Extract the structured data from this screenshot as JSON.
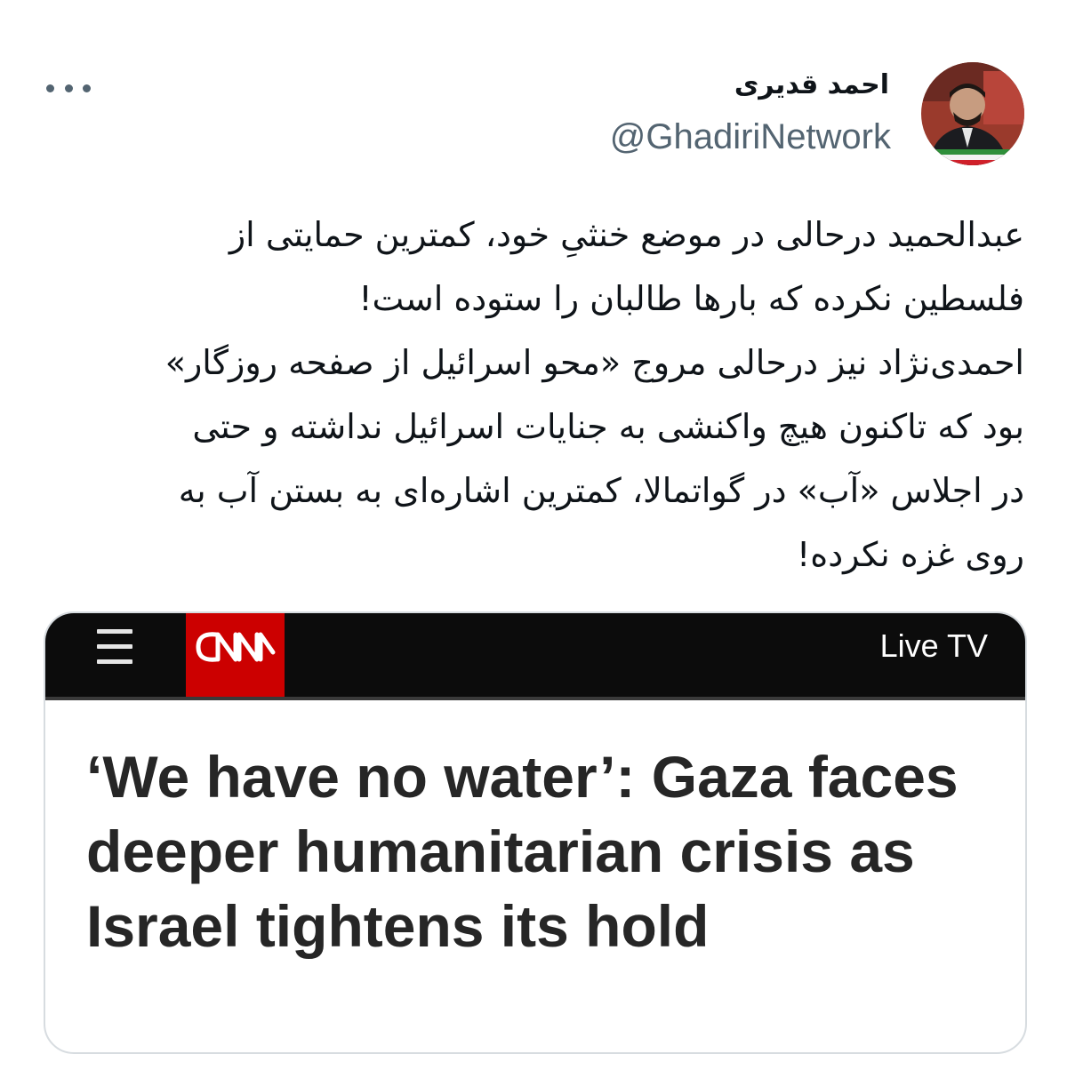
{
  "tweet": {
    "author_name": "احمد قدیری",
    "author_handle": "@GhadiriNetwork",
    "more_icon": "more-horizontal-icon",
    "text_lines": [
      "عبدالحمید درحالی در موضع خنثیِ خود، کمترین حمایتی از",
      "فلسطین نکرده که بارها طالبان را ستوده است!",
      "احمدی‌نژاد نیز درحالی مروج «محو اسرائیل از صفحه روزگار»",
      "بود که تاکنون هیچ واکنشی به جنایات اسرائیل نداشته و حتی",
      "در اجلاس «آب» در گواتمالا، کمترین اشاره‌ای به بستن آب به",
      "روی غزه نکرده!"
    ]
  },
  "link_card": {
    "site_logo": "CNN",
    "menu_icon": "hamburger-menu-icon",
    "live_tv_label": "Live TV",
    "headline": "‘We have no water’: Gaza faces deeper humanitarian crisis as Israel tightens its hold",
    "colors": {
      "brand_red": "#cc0000",
      "bar_black": "#0c0c0c"
    }
  }
}
